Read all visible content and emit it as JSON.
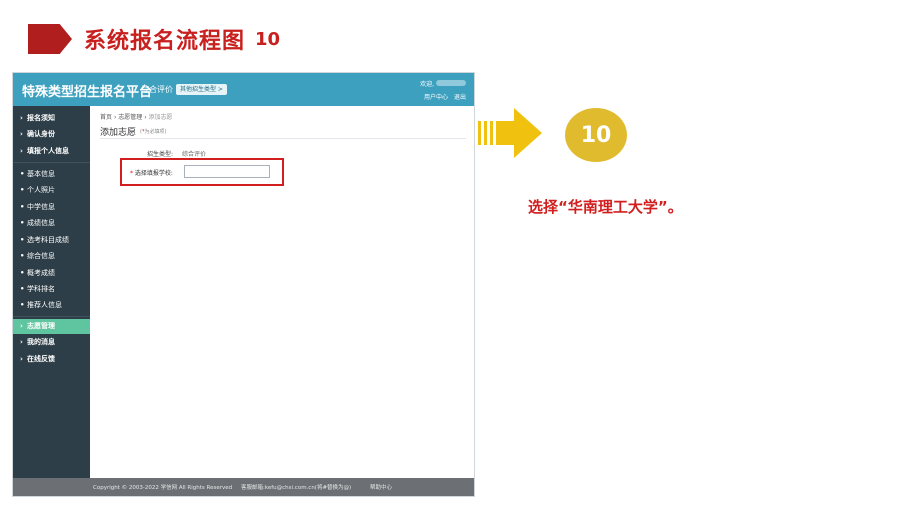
{
  "slide": {
    "title": "系统报名流程图",
    "step": "10"
  },
  "platform": {
    "name": "特殊类型招生报名平台",
    "eval_link": "综合评价",
    "switch_button": "其他招生类型 >",
    "welcome": "欢迎,",
    "user_center": "用户中心",
    "logout": "退出"
  },
  "sidebar": {
    "main_top": [
      "报名须知",
      "确认身份",
      "填报个人信息"
    ],
    "sub_items": [
      "基本信息",
      "个人照片",
      "中学信息",
      "成绩信息",
      "选考科目成绩",
      "综合信息",
      "概考成绩",
      "学科排名",
      "推荐人信息"
    ],
    "main_bottom": [
      "志愿管理",
      "我的消息",
      "在线反馈"
    ],
    "active": "志愿管理"
  },
  "content": {
    "breadcrumb": [
      "首页",
      "志愿管理",
      "添加志愿"
    ],
    "heading": "添加志愿",
    "required_note": "为必填项",
    "type_label": "招生类型:",
    "type_value": "综合评价",
    "school_label": "选择填报学校:",
    "school_value": ""
  },
  "footer": {
    "copyright": "Copyright © 2003-2022 学信网 All Rights Reserved",
    "email": "客服邮箱:kefu@chsi.com.cn(将#替换为@)",
    "help": "帮助中心"
  },
  "instruction": {
    "text": "选择“华南理工大学”。"
  },
  "colors": {
    "title_red": "#c8201e",
    "topbar": "#3da0bf",
    "sidebar": "#2d3e48",
    "active_item": "#5fc4a0",
    "highlight": "#d11f1f",
    "arrow_yellow": "#f0c20f",
    "circle": "#e1bb2e"
  }
}
